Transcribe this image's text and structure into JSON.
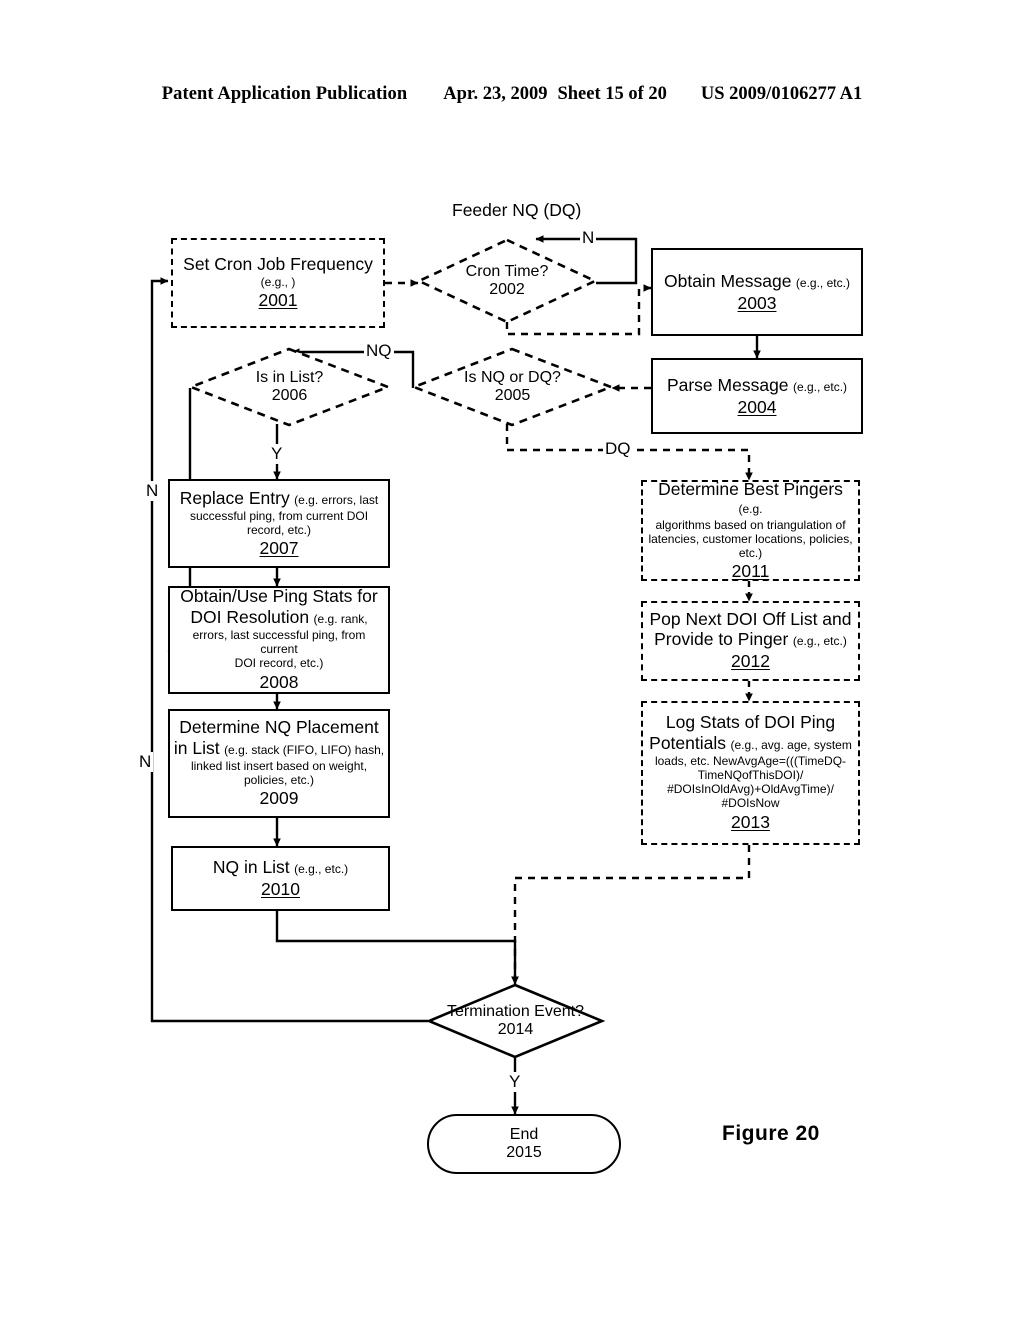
{
  "header": {
    "publication": "Patent Application Publication",
    "date": "Apr. 23, 2009",
    "sheet": "Sheet 15 of 20",
    "number": "US 2009/0106277 A1"
  },
  "figure": {
    "caption": "Figure  20"
  },
  "diagram": {
    "title_label": "Feeder NQ (DQ)",
    "nodes": [
      {
        "id": "2001",
        "shape": "process",
        "border": "dashed",
        "line1": "Set Cron Job Frequency",
        "line2": "(e.g., )",
        "ref": "2001"
      },
      {
        "id": "2002",
        "shape": "decision",
        "border": "dashed",
        "line1": "Cron Time?",
        "ref": "2002"
      },
      {
        "id": "2003",
        "shape": "process",
        "border": "solid",
        "line1": "Obtain Message",
        "line1b": "(e.g., etc.)",
        "ref": "2003"
      },
      {
        "id": "2004",
        "shape": "process",
        "border": "solid",
        "line1": "Parse Message",
        "line1b": "(e.g., etc.)",
        "ref": "2004"
      },
      {
        "id": "2005",
        "shape": "decision",
        "border": "dashed",
        "line1": "Is NQ or DQ?",
        "ref": "2005"
      },
      {
        "id": "2006",
        "shape": "decision",
        "border": "dashed",
        "line1": "Is in List?",
        "ref": "2006"
      },
      {
        "id": "2007",
        "shape": "process",
        "border": "solid",
        "line1": "Replace Entry",
        "line1b": "(e.g. errors, last",
        "line2": "successful ping, from current DOI",
        "line3": "record, etc.)",
        "ref": "2007"
      },
      {
        "id": "2008",
        "shape": "process",
        "border": "solid",
        "line1": "Obtain/Use Ping Stats for",
        "line2": "DOI Resolution",
        "line2b": "(e.g. rank,",
        "line3": "errors, last successful ping, from current",
        "line4": "DOI record, etc.)",
        "ref": "2008"
      },
      {
        "id": "2009",
        "shape": "process",
        "border": "solid",
        "line1": "Determine NQ Placement",
        "line2": "in List",
        "line2b": "(e.g. stack (FIFO, LIFO) hash,",
        "line3": "linked list insert based on weight,",
        "line4": "policies, etc.)",
        "ref": "2009"
      },
      {
        "id": "2010",
        "shape": "process",
        "border": "solid",
        "line1": "NQ in List",
        "line1b": "(e.g., etc.)",
        "ref": "2010"
      },
      {
        "id": "2011",
        "shape": "process",
        "border": "dashed",
        "line1": "Determine Best Pingers",
        "line1b": "(e.g.",
        "line2": "algorithms based on triangulation of",
        "line3": "latencies, customer locations, policies,",
        "line4": "etc.)",
        "ref": "2011"
      },
      {
        "id": "2012",
        "shape": "process",
        "border": "dashed",
        "line1": "Pop Next DOI Off List and",
        "line2": "Provide to Pinger",
        "line2b": "(e.g., etc.)",
        "ref": "2012"
      },
      {
        "id": "2013",
        "shape": "process",
        "border": "dashed",
        "line1": "Log Stats of DOI Ping",
        "line2": "Potentials",
        "line2b": "(e.g., avg. age, system",
        "line3": "loads, etc. NewAvgAge=(((TimeDQ-",
        "line4": "TimeNQofThisDOI)/",
        "line5": "#DOIsInOldAvg)+OldAvgTime)/",
        "line6": "#DOIsNow",
        "ref": "2013"
      },
      {
        "id": "2014",
        "shape": "decision",
        "border": "solid",
        "line1": "Termination Event?",
        "ref": "2014"
      },
      {
        "id": "2015",
        "shape": "terminator",
        "border": "solid",
        "line1": "End",
        "ref": "2015"
      }
    ],
    "edge_labels": {
      "cron_no": "N",
      "nq": "NQ",
      "dq": "DQ",
      "is_in_list_yes": "Y",
      "is_in_list_no": "N",
      "termination_no": "N",
      "termination_yes": "Y"
    }
  }
}
